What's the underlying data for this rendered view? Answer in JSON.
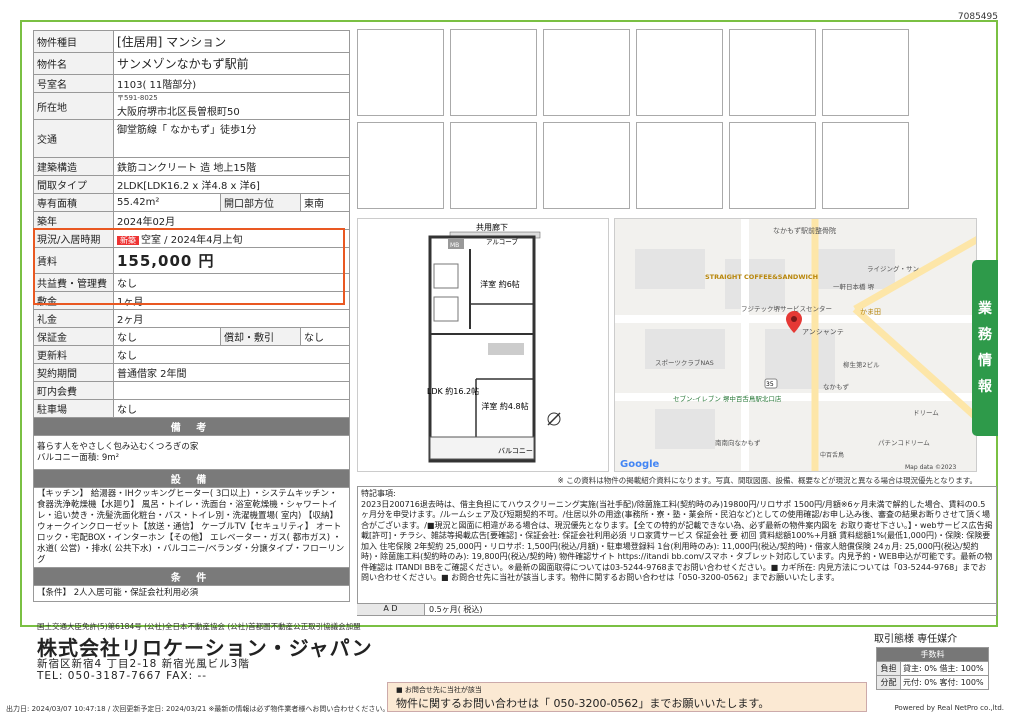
{
  "doc_id": "7085495",
  "spec": {
    "type_k": "物件種目",
    "type_v": "[住居用] マンション",
    "name_k": "物件名",
    "name_v": "サンメゾンなかもず駅前",
    "room_k": "号室名",
    "room_v": "1103( 11階部分)",
    "addr_k": "所在地",
    "zip": "〒591-8025",
    "addr_v": "大阪府堺市北区長曽根町50",
    "access_k": "交通",
    "access_v": "御堂筋線「 なかもず」徒歩1分",
    "struct_k": "建築構造",
    "struct_v": "鉄筋コンクリート 造 地上15階",
    "layout_k": "間取タイプ",
    "layout_v": "2LDK[LDK16.2 x 洋4.8 x 洋6]",
    "area_k": "専有面積",
    "area_v": "55.42m²",
    "window_k": "開口部方位",
    "window_v": "東南",
    "built_k": "築年",
    "built_v": "2024年02月",
    "status_k": "現況/入居時期",
    "status_new": "新築",
    "status_v": "空室 / 2024年4月上旬",
    "rent_k": "賃料",
    "rent_v": "155,000 円",
    "fee_k": "共益費・管理費",
    "fee_v": "なし",
    "deposit_k": "敷金",
    "deposit_v": "1ヶ月",
    "keymoney_k": "礼金",
    "keymoney_v": "2ヶ月",
    "guarantee_k": "保証金",
    "guarantee_v": "なし",
    "amort_k": "償却・敷引",
    "amort_v": "なし",
    "renew_k": "更新料",
    "renew_v": "なし",
    "contract_k": "契約期間",
    "contract_v": "普通借家 2年間",
    "assoc_k": "町内会費",
    "assoc_v": "",
    "parking_k": "駐車場",
    "parking_v": "なし",
    "remarks_h": "備 考",
    "remarks_1": "暮らす人をやさしく包み込むくつろぎの家",
    "remarks_2": "バルコニー面積: 9m²",
    "equip_h": "設 備",
    "equip_v": "【キッチン】 給湯器・IHクッキングヒーター( 3口以上) ・システムキッチン・食器洗浄乾燥機【水廻り】 風呂・トイレ・洗面台・浴室乾燥機・シャワートイレ・追い焚き・洗髪洗面化粧台・バス・トイレ別・洗濯機置場( 室内) 【収納】 ウォークインクローゼット【放送・通信】 ケーブルTV【セキュリティ】 オートロック・宅配BOX・インターホン【その他】 エレベーター・ガス( 都市ガス) ・水道( 公営) ・排水( 公共下水) ・バルコニー/ベランダ・分譲タイプ・フローリング",
    "cond_h": "条 件",
    "cond_v": "【条件】 2人入居可能・保証会社利用必須"
  },
  "floorplan": {
    "corridor": "共用廊下",
    "alcove": "アルコーブ",
    "mb": "MB",
    "wr": "洋室\n約6帖",
    "ldk": "LDK\n約16.2帖",
    "wr2": "洋室\n約4.8帖",
    "balcony": "バルコニー"
  },
  "map": {
    "label1": "なかもず駅前整骨院",
    "label2": "STRAIGHT COFFEE&SANDWICH",
    "label3": "フジテック堺サービスセンター",
    "label4": "かま田",
    "label5": "アンシャンテ",
    "label6": "スポーツクラブNAS",
    "label7": "セブン-イレブン 堺中百舌鳥駅北口店",
    "label8": "南南向なかもず",
    "label9": "パチンコドリーム",
    "label10": "ドリーム",
    "label11": "ライジング・サン",
    "label12": "一軒日本橋 堺",
    "label13": "柳生第2ビル",
    "label14": "なかもず",
    "label15": "中百舌鳥",
    "badge": "35",
    "google": "Google",
    "credit": "Map data ©2023"
  },
  "map_note": "※ この資料は物件の掲載紹介資料になります。写真、間取図面、設備、概要などが現況と異なる場合は現況優先となります。",
  "side_tab": [
    "業",
    "務",
    "情",
    "報"
  ],
  "special": {
    "title": "特記事項:",
    "body": "2023日200716退去時は、借主負担にてハウスクリーニング実施(当社手配)/除菌施工料(契約時のみ)19800円/リロサポ 1500円/月額※6ヶ月未満で解約した場合、賃料の0.5ヶ月分を申受けます。/ルームシェア及び短期契約不可。/住居以外の用途(事務所・寮・塾・業会所・民泊など)としての使用確認/お申し込み後、審査の結果お断りさせて頂く場合がございます。/■現況と図面に相違がある場合は、現況優先となります。【全ての特約が記載できない為、必ず最新の物件案内図を お取り寄せ下さい。】・webサービス広告掲載[許可]・チラシ、雑誌等掲載広告[要確認]・保証会社: 保証会社利用必須 リロ家賃サービス 保証会社 要 初回 賃料総額100%+月額 賃料総額1%(最低1,000円)・保険: 保険要加入 住宅保険 2年契約 25,000円・リロサポ: 1,500円(税込/月額)・駐車場登録料 1台(利用時のみ): 11,000円(税込/契約時)・借家人賠償保険 24ヵ月: 25,000円(税込/契約時)・除菌施工料(契約時のみ): 19,800円(税込/契約時) 物件確認サイト https://itandi bb.com/スマホ・タブレット対応しています。内見予約・WEB申込が可能です。最新の物件確認は ITANDI BBをご確認ください。※最新の図面取得については03-5244-9768までお問い合わせください。■ カギ所在: 内見方法については「03-5244-9768」までお問い合わせください。■ お問合せ先に当社が該当します。物件に関するお問い合わせは「050-3200-0562」までお願いいたします。",
    "ad_k": "A D",
    "ad_v": "0.5ヶ月( 税込)"
  },
  "company": {
    "assoc": "国土交通大臣免許(5)第6184号 (公社)全日本不動産協会 (公社)首都圏不動産公正取引協議会加盟",
    "name": "株式会社リロケーション・ジャパン",
    "addr": "新宿区新宿4 丁目2-18 新宿光風ビル3階",
    "tel": "TEL: 050-3187-7667 FAX: --"
  },
  "brokerage": {
    "title": "取引態様 専任媒介",
    "h": "手数料",
    "r1k": "負担",
    "r1v": "貸主: 0% 借主: 100%",
    "r2k": "分配",
    "r2v": "元付: 0% 客付: 100%"
  },
  "inquiry": {
    "small": "■ お問合せ先に当社が該当",
    "main": "物件に関するお問い合わせは「 050-3200-0562」までお願いいたします。"
  },
  "footer_left": "出力日: 2024/03/07 10:47:18 / 次回更新予定日: 2024/03/21 ※最新の情報は必ず物件業者様へお問い合わせください。",
  "footer_right": "Powered by Real NetPro co.,ltd."
}
